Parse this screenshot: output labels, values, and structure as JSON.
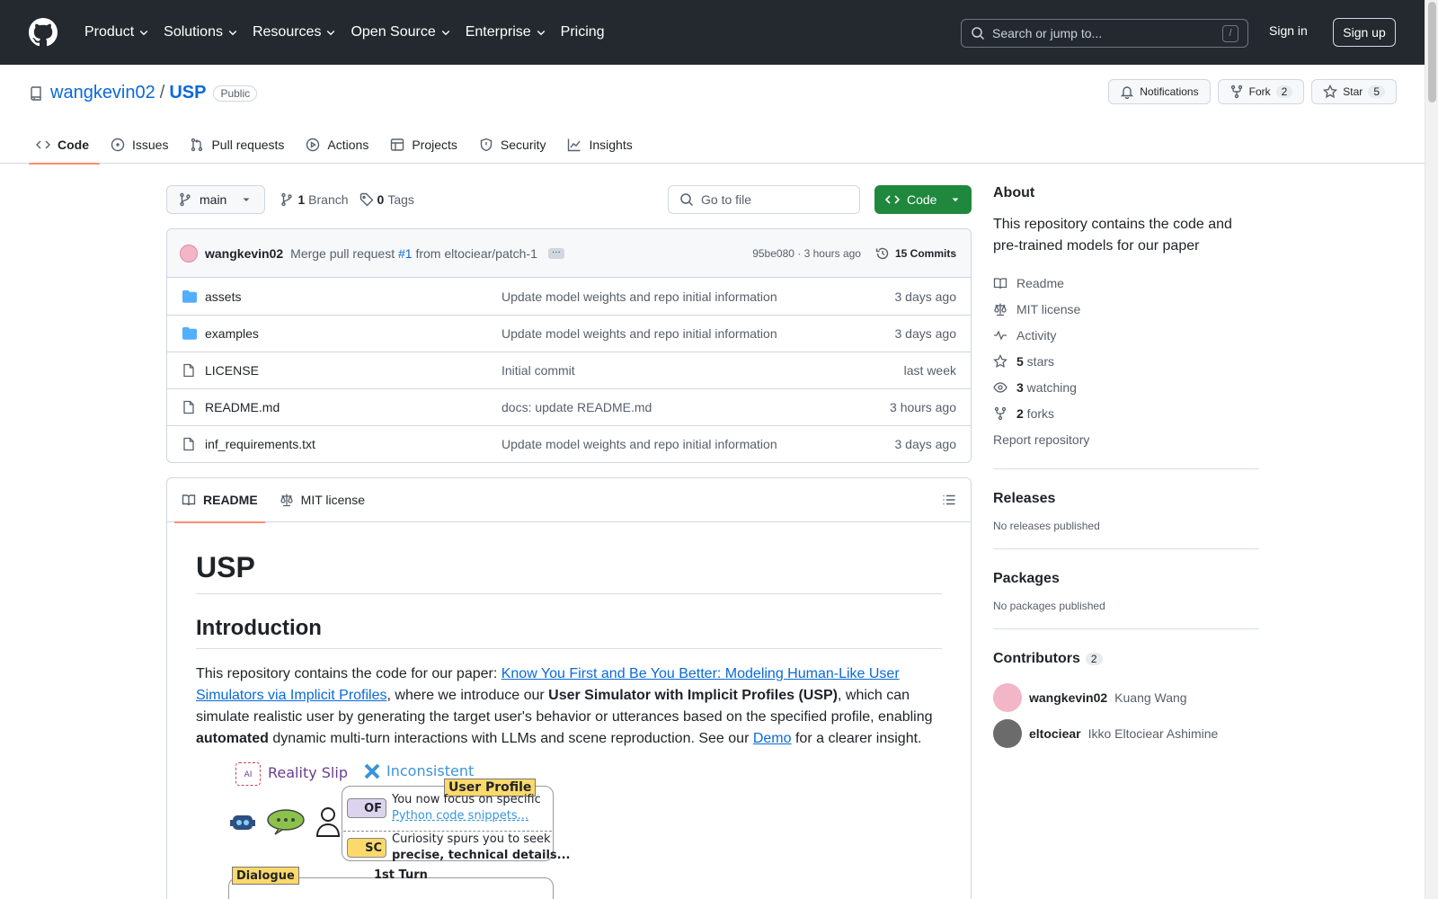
{
  "header": {
    "nav": [
      {
        "label": "Product",
        "dropdown": true
      },
      {
        "label": "Solutions",
        "dropdown": true
      },
      {
        "label": "Resources",
        "dropdown": true
      },
      {
        "label": "Open Source",
        "dropdown": true
      },
      {
        "label": "Enterprise",
        "dropdown": true
      },
      {
        "label": "Pricing",
        "dropdown": false
      }
    ],
    "search_placeholder": "Search or jump to...",
    "search_shortcut": "/",
    "sign_in": "Sign in",
    "sign_up": "Sign up"
  },
  "repo": {
    "owner": "wangkevin02",
    "separator": "/",
    "name": "USP",
    "visibility": "Public",
    "notifications_label": "Notifications",
    "fork_label": "Fork",
    "fork_count": "2",
    "star_label": "Star",
    "star_count": "5",
    "tabs": [
      "Code",
      "Issues",
      "Pull requests",
      "Actions",
      "Projects",
      "Security",
      "Insights"
    ]
  },
  "toolbar": {
    "branch": "main",
    "branch_count": "1",
    "branch_label": "Branch",
    "tag_count": "0",
    "tag_label": "Tags",
    "goto_placeholder": "Go to file",
    "code_button": "Code"
  },
  "commit": {
    "author": "wangkevin02",
    "message_prefix": "Merge pull request",
    "pr": "#1",
    "message_suffix": "from eltociear/patch-1",
    "ellipsis": "···",
    "hash_time": "95be080 · 3 hours ago",
    "commits_label": "15 Commits"
  },
  "files": [
    {
      "type": "dir",
      "name": "assets",
      "message": "Update model weights and repo initial information",
      "time": "3 days ago"
    },
    {
      "type": "dir",
      "name": "examples",
      "message": "Update model weights and repo initial information",
      "time": "3 days ago"
    },
    {
      "type": "file",
      "name": "LICENSE",
      "message": "Initial commit",
      "time": "last week"
    },
    {
      "type": "file",
      "name": "README.md",
      "message": "docs: update README.md",
      "time": "3 hours ago"
    },
    {
      "type": "file",
      "name": "inf_requirements.txt",
      "message": "Update model weights and repo initial information",
      "time": "3 days ago"
    }
  ],
  "readme": {
    "tab_readme": "README",
    "tab_license": "MIT license",
    "h1": "USP",
    "h2": "Introduction",
    "p1": "This repository contains the code for our paper: ",
    "paper_link": "Know You First and Be You Better: Modeling Human-Like User Simulators via Implicit Profiles",
    "p2": ", where we introduce our ",
    "bold1": "User Simulator with Implicit Profiles (USP)",
    "p3": ", which can simulate realistic user by generating the target user's behavior or utterances based on the specified profile, enabling ",
    "bold2": "automated",
    "p4": " dynamic multi-turn interactions with LLMs and scene reproduction. See our ",
    "demo_link": "Demo",
    "p5": " for a clearer insight.",
    "figure": {
      "ai_tag": "AI",
      "reality_slip": "Reality Slip",
      "inconsistent": "Inconsistent",
      "user_profile": "User Profile",
      "of_tag": "OF",
      "of_line1": "You now focus on specific",
      "of_line2": "Python code snippets...",
      "sc_tag": "SC",
      "sc_line1": "Curiosity spurs you to seek",
      "sc_line2": "precise, technical details...",
      "dialogue": "Dialogue",
      "turn": "1st Turn"
    }
  },
  "about": {
    "title": "About",
    "description": "This repository contains the code and pre-trained models for our paper",
    "links": [
      {
        "icon": "book-icon",
        "label": "Readme",
        "bold": ""
      },
      {
        "icon": "law-icon",
        "label": "MIT license",
        "bold": ""
      },
      {
        "icon": "pulse-icon",
        "label": "Activity",
        "bold": ""
      },
      {
        "icon": "star-icon",
        "label": " stars",
        "bold": "5"
      },
      {
        "icon": "eye-icon",
        "label": " watching",
        "bold": "3"
      },
      {
        "icon": "fork-icon",
        "label": " forks",
        "bold": "2"
      }
    ],
    "report": "Report repository"
  },
  "releases": {
    "title": "Releases",
    "empty": "No releases published"
  },
  "packages": {
    "title": "Packages",
    "empty": "No packages published"
  },
  "contributors": {
    "title": "Contributors",
    "count": "2",
    "list": [
      {
        "login": "wangkevin02",
        "name": "Kuang Wang",
        "color": "#f3b6c6"
      },
      {
        "login": "eltociear",
        "name": "Ikko Eltociear Ashimine",
        "color": "#6b6b6b"
      }
    ]
  },
  "colors": {
    "header_bg": "#24292f",
    "link": "#0969da",
    "code_green": "#1f883d",
    "tab_underline": "#fd8c73"
  }
}
